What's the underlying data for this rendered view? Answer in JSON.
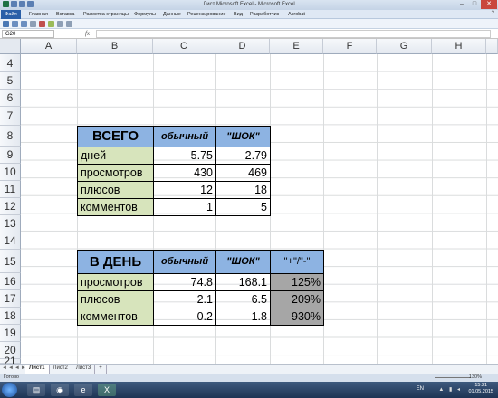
{
  "window": {
    "title": "Лист Microsoft Excel  -  Microsoft Excel",
    "controls": [
      "–",
      "□",
      "✕"
    ]
  },
  "ribbon": {
    "file_label": "Файл",
    "tabs": [
      "Главная",
      "Вставка",
      "Разметка страницы",
      "Формулы",
      "Данные",
      "Рецензирование",
      "Вид",
      "Разработчик",
      "Acrobat"
    ]
  },
  "formula_bar": {
    "name_box": "G20",
    "fx": "fx",
    "value": ""
  },
  "columns": [
    "A",
    "B",
    "C",
    "D",
    "E",
    "F",
    "G",
    "H"
  ],
  "rows": [
    "4",
    "5",
    "6",
    "7",
    "8",
    "9",
    "10",
    "11",
    "12",
    "13",
    "14",
    "15",
    "16",
    "17",
    "18",
    "19",
    "20",
    "21"
  ],
  "table_total": {
    "header": [
      "ВСЕГО",
      "обычный",
      "\"ШОК\""
    ],
    "rows": [
      {
        "label": "дней",
        "normal": "5.75",
        "shock": "2.79"
      },
      {
        "label": "просмотров",
        "normal": "430",
        "shock": "469"
      },
      {
        "label": "плюсов",
        "normal": "12",
        "shock": "18"
      },
      {
        "label": "комментов",
        "normal": "1",
        "shock": "5"
      }
    ]
  },
  "table_daily": {
    "header": [
      "В ДЕНЬ",
      "обычный",
      "\"ШОК\"",
      "\"+\"/\"-\""
    ],
    "rows": [
      {
        "label": "просмотров",
        "normal": "74.8",
        "shock": "168.1",
        "ratio": "125%"
      },
      {
        "label": "плюсов",
        "normal": "2.1",
        "shock": "6.5",
        "ratio": "209%"
      },
      {
        "label": "комментов",
        "normal": "0.2",
        "shock": "1.8",
        "ratio": "930%"
      }
    ]
  },
  "sheets": {
    "nav": "◄◄◄►►",
    "tabs": [
      "Лист1",
      "Лист2",
      "Лист3"
    ],
    "active": "Лист1"
  },
  "status": {
    "ready": "Готово",
    "zoom": "130%"
  },
  "taskbar": {
    "lang": "EN",
    "time": "15:21",
    "date": "01.05.2015"
  },
  "colors": {
    "header_blue": "#8db3e2",
    "label_green": "#d7e4bc",
    "ratio_grey": "#a6a6a6"
  }
}
